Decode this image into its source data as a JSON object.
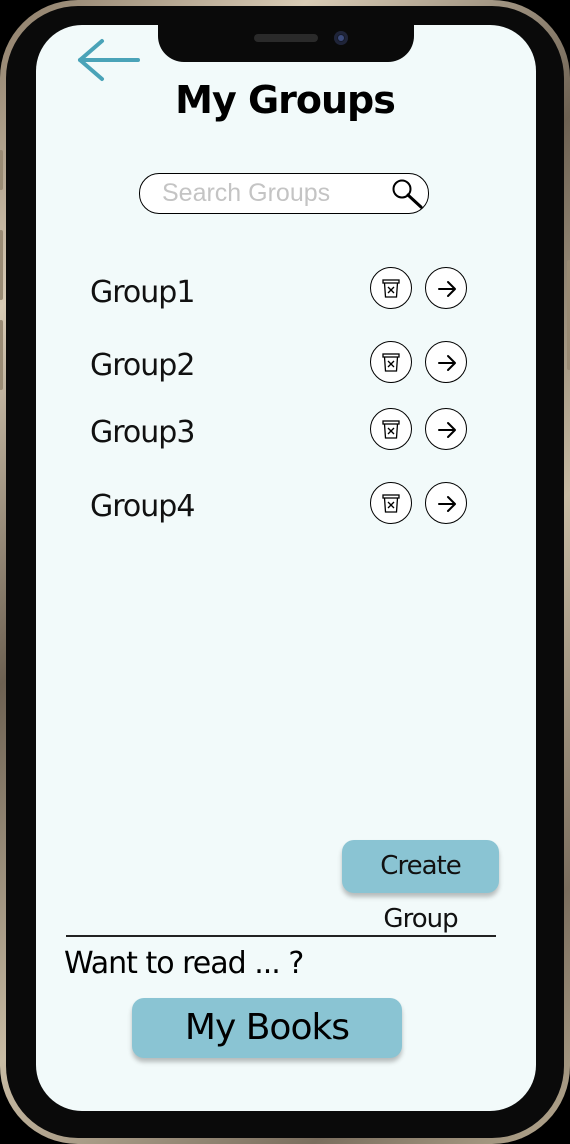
{
  "header": {
    "title": "My Groups",
    "back_icon": "back-arrow-icon"
  },
  "search": {
    "placeholder": "Search Groups",
    "value": "",
    "icon": "search-icon"
  },
  "groups": [
    {
      "name": "Group1",
      "delete_icon": "trash-icon",
      "open_icon": "arrow-right-icon"
    },
    {
      "name": "Group2",
      "delete_icon": "trash-icon",
      "open_icon": "arrow-right-icon"
    },
    {
      "name": "Group3",
      "delete_icon": "trash-icon",
      "open_icon": "arrow-right-icon"
    },
    {
      "name": "Group4",
      "delete_icon": "trash-icon",
      "open_icon": "arrow-right-icon"
    }
  ],
  "actions": {
    "create_group_label": "Create Group"
  },
  "footer": {
    "prompt": "Want to read ... ?",
    "my_books_label": "My Books"
  },
  "colors": {
    "accent": "#8ac4d3",
    "back_arrow": "#4aa3b8",
    "screen_background": "#f2fafa"
  }
}
